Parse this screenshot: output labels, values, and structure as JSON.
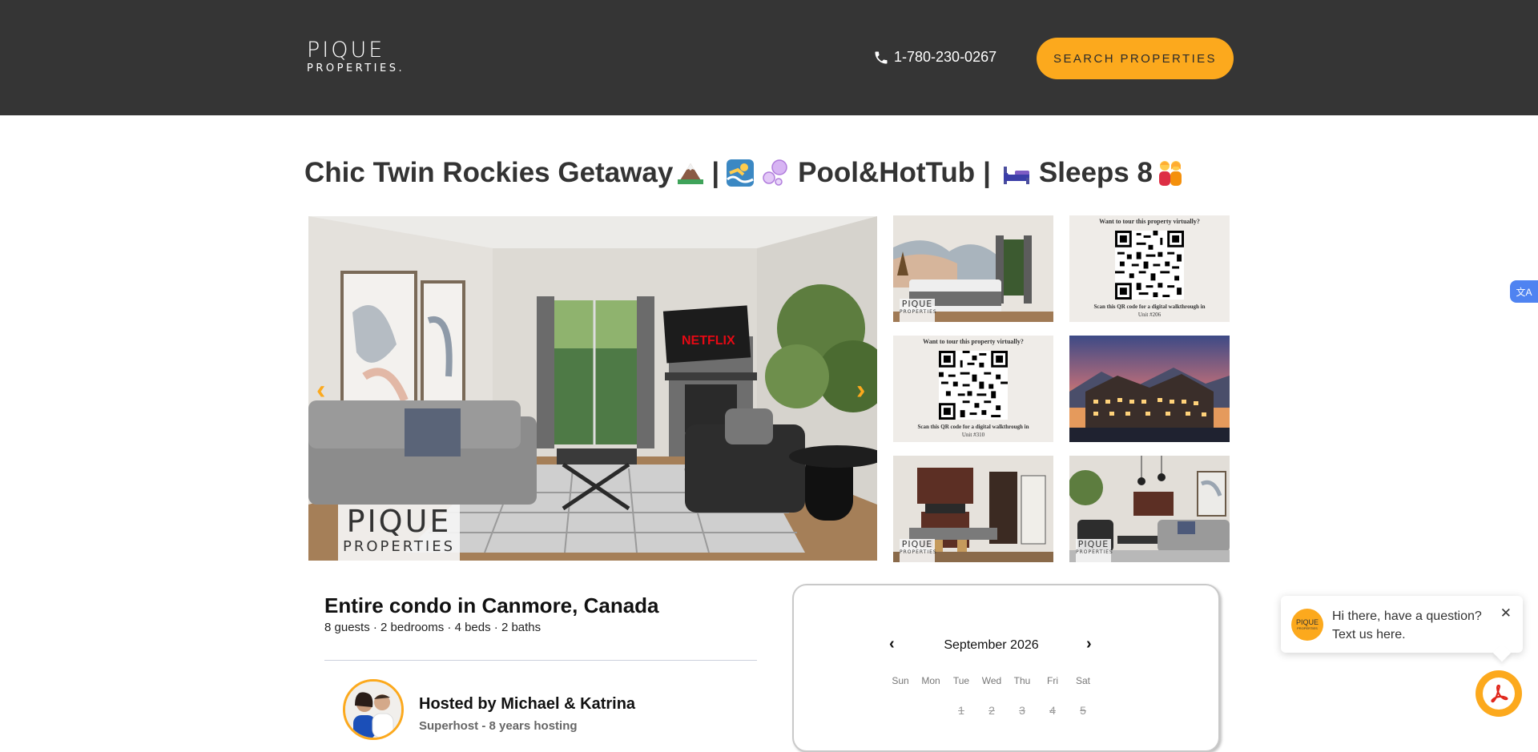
{
  "header": {
    "logo_main": "PIQUE",
    "logo_sub": "PROPERTIES.",
    "phone": "1-780-230-0267",
    "search_label": "SEARCH PROPERTIES",
    "bg_color": "#353535",
    "accent_color": "#fca91d"
  },
  "title": {
    "part1": "Chic Twin Rockies Getaway",
    "part2": "|",
    "part3": "Pool&HotTub",
    "part4": "|",
    "part5": "Sleeps 8"
  },
  "gallery": {
    "prev_icon": "‹",
    "next_icon": "›",
    "netflix": "NETFLIX",
    "watermark_main": "PIQUE",
    "watermark_sub": "PROPERTIES",
    "qr1_heading": "Want to tour this property virtually?",
    "qr1_caption": "Scan this QR code for a digital walkthrough in",
    "qr1_unit": "Unit #206",
    "qr2_heading": "Want to tour this property virtually?",
    "qr2_caption": "Scan this QR code for a digital walkthrough in",
    "qr2_unit": "Unit #310"
  },
  "listing": {
    "title": "Entire condo in Canmore, Canada",
    "details": "8 guests · 2 bedrooms · 4 beds · 2 baths",
    "host_name": "Hosted by Michael & Katrina",
    "host_sub": "Superhost - 8 years hosting"
  },
  "calendar": {
    "month": "September 2026",
    "prev": "‹",
    "next": "›",
    "days_of_week": [
      "Sun",
      "Mon",
      "Tue",
      "Wed",
      "Thu",
      "Fri",
      "Sat"
    ],
    "first_row": [
      "1",
      "2",
      "3",
      "4",
      "5"
    ]
  },
  "chat": {
    "line1": "Hi there, have a question?",
    "line2": "Text us here.",
    "close": "✕",
    "logo_main": "PIQUE",
    "logo_sub": "PROPERTIES"
  },
  "translate_label": "文A"
}
